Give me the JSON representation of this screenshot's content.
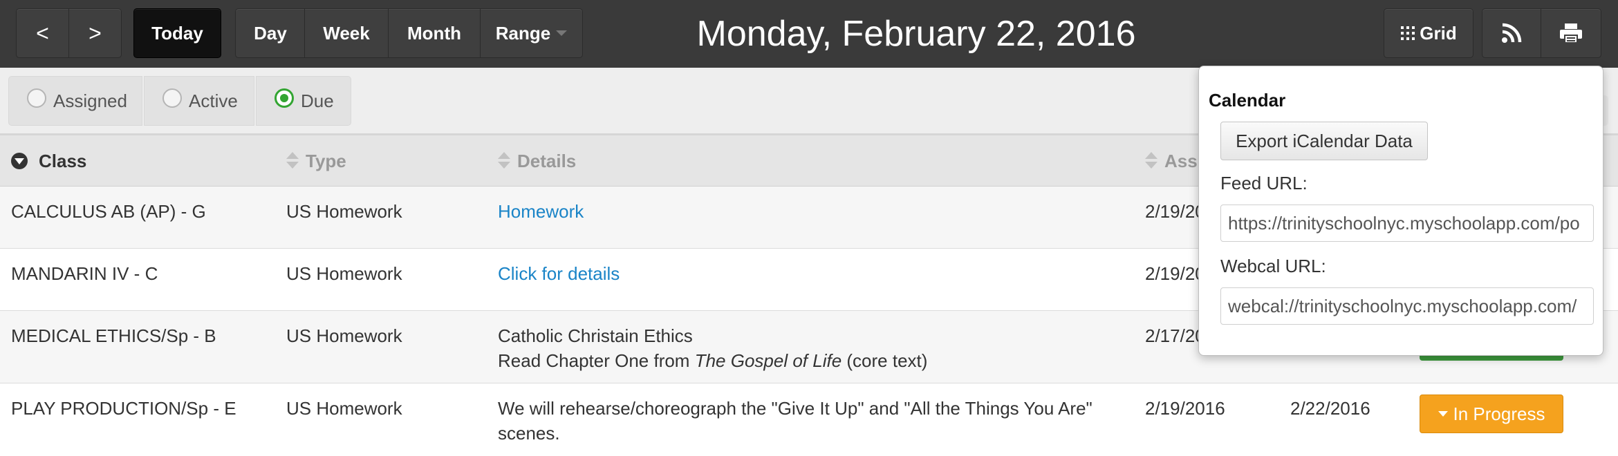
{
  "toolbar": {
    "prev_label": "<",
    "next_label": ">",
    "today_label": "Today",
    "day_label": "Day",
    "week_label": "Week",
    "month_label": "Month",
    "range_label": "Range",
    "date_title": "Monday, February 22, 2016",
    "grid_label": "Grid",
    "rss_icon": "rss-icon",
    "print_icon": "print-icon"
  },
  "filters": {
    "options": [
      {
        "label": "Assigned",
        "checked": false
      },
      {
        "label": "Active",
        "checked": false
      },
      {
        "label": "Due",
        "checked": true
      }
    ],
    "accent_color": "#33a532"
  },
  "table": {
    "columns": [
      "Class",
      "Type",
      "Details",
      "Assi"
    ],
    "rows": [
      {
        "class": "CALCULUS AB (AP) - G",
        "type": "US Homework",
        "details": "Homework",
        "details_is_link": true,
        "assigned": "2/19/20"
      },
      {
        "class": "MANDARIN IV - C",
        "type": "US Homework",
        "details": "Click for details",
        "details_is_link": true,
        "assigned": "2/19/20"
      },
      {
        "class": "MEDICAL ETHICS/Sp - B",
        "type": "US Homework",
        "details_line1": "Catholic Christain Ethics",
        "details_line2_pre": "Read Chapter One from ",
        "details_line2_italic": "The Gospel of Life",
        "details_line2_post": " (core text)",
        "assigned": "2/17/20"
      },
      {
        "class": "PLAY PRODUCTION/Sp - E",
        "type": "US Homework",
        "details_line1": "We will rehearse/choreograph the \"Give It Up\" and \"All the Things You Are\"",
        "details_line2": "scenes.",
        "assigned": "2/19/2016",
        "due": "2/22/2016",
        "status": "In Progress"
      }
    ],
    "status_color": "#f5a21e",
    "link_color": "#1a84c7"
  },
  "calendar_popover": {
    "title": "Calendar",
    "export_label": "Export iCalendar Data",
    "feed_label": "Feed URL:",
    "feed_value": "https://trinityschoolnyc.myschoolapp.com/po",
    "webcal_label": "Webcal URL:",
    "webcal_value": "webcal://trinityschoolnyc.myschoolapp.com/"
  }
}
